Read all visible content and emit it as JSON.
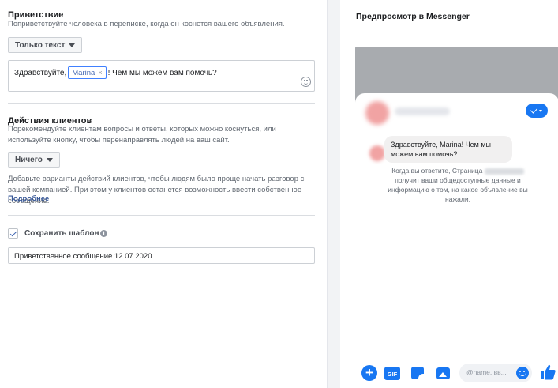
{
  "greeting": {
    "title": "Приветствие",
    "description": "Поприветствуйте человека в переписке, когда он коснется вашего объявления.",
    "format_dropdown": "Только текст",
    "text_before": "Здравствуйте,",
    "token": "Marina",
    "token_remove": "×",
    "text_after": "! Чем мы можем вам помочь?"
  },
  "actions": {
    "title": "Действия клиентов",
    "description": "Порекомендуйте клиентам вопросы и ответы, которых можно коснуться, или используйте кнопку, чтобы перенаправлять людей на ваш сайт.",
    "dropdown": "Ничего",
    "note": "Добавьте варианты действий клиентов, чтобы людям было проще начать разговор с вашей компанией. При этом у клиентов останется возможность ввести собственное сообщение.",
    "more_link": "Подробнее"
  },
  "template": {
    "save_label": "Сохранить шаблон",
    "save_checked": true,
    "info_glyph": "i",
    "name_value": "Приветственное сообщение 12.07.2020"
  },
  "preview": {
    "title": "Предпросмотр в Messenger",
    "bubble_text": "Здравствуйте, Marina! Чем мы можем вам помочь?",
    "consent_before": "Когда вы ответите, Страница",
    "consent_after": "получит ваши общедоступные данные и информацию о том, на какое объявление вы нажали.",
    "composer_placeholder": "@name, вв...",
    "composer_icons": [
      "plus-icon",
      "gif-icon",
      "sticker-icon",
      "photo-icon",
      "emoji-icon",
      "like-icon"
    ],
    "gif_label": "GIF",
    "plus_glyph": "+"
  },
  "colors": {
    "accent": "#1877f2",
    "link": "#385898",
    "overlay": "#a8abaf"
  }
}
